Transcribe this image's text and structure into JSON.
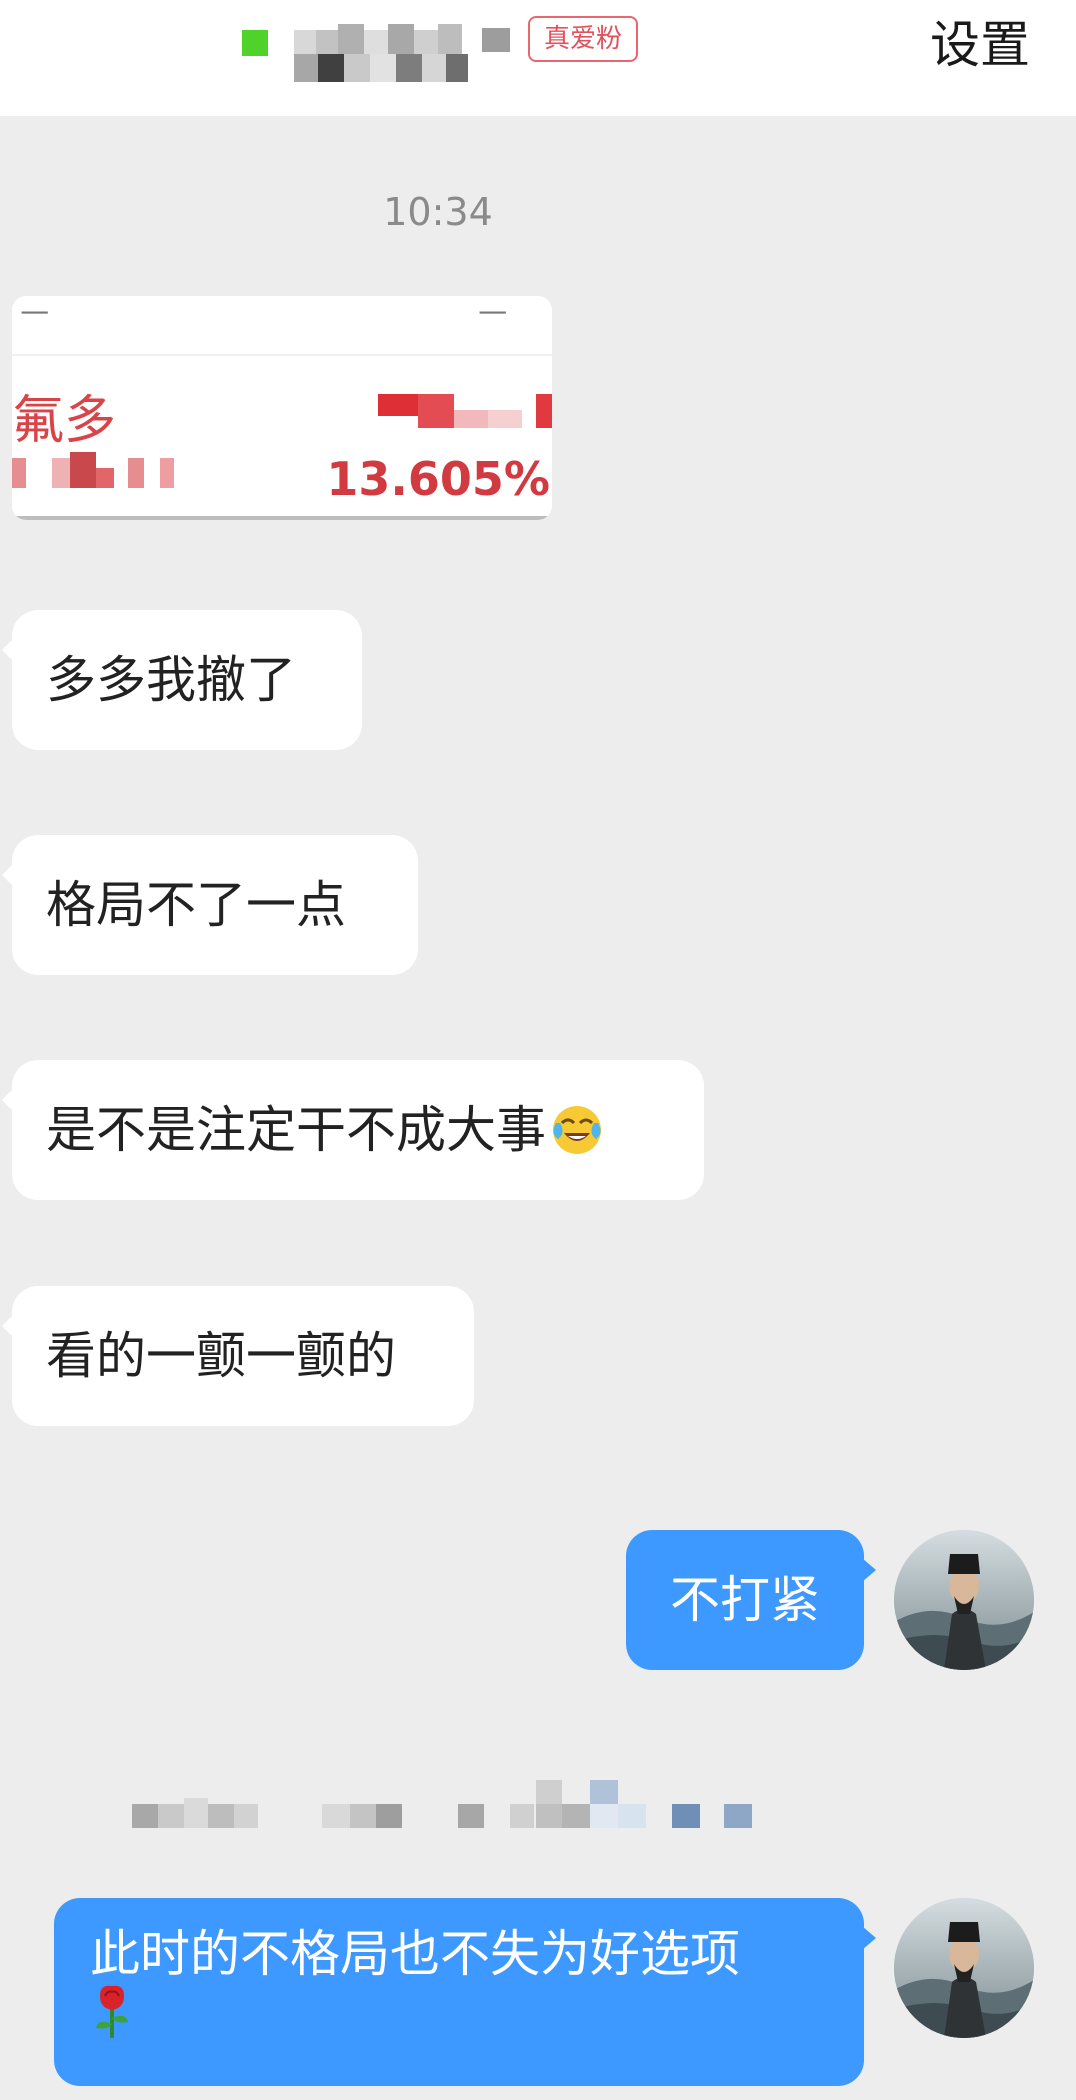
{
  "header": {
    "badge": "真爱粉",
    "settings": "设置",
    "online_color": "#4fd22a"
  },
  "chat": {
    "timestamp": "10:34",
    "shared_image": {
      "name": "氟多",
      "percent": "13.605%"
    },
    "incoming": [
      {
        "text": "多多我撤了"
      },
      {
        "text": "格局不了一点"
      },
      {
        "text": "是不是注定干不成大事",
        "emoji": "face-with-tears-of-joy-icon"
      },
      {
        "text": "看的一颤一颤的"
      }
    ],
    "outgoing": [
      {
        "text": "不打紧"
      },
      {
        "text": "此时的不格局也不失为好选项",
        "emoji": "rose-icon"
      }
    ]
  },
  "colors": {
    "outgoing_bubble": "#3d98ff",
    "incoming_bubble": "#ffffff",
    "background": "#ededed",
    "badge": "#e0525c"
  }
}
